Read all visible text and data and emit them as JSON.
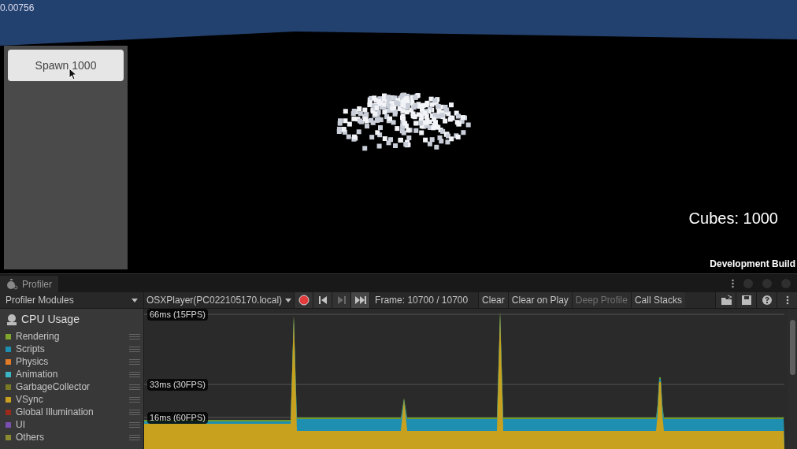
{
  "game_view": {
    "fps_readout": "0.00756",
    "spawn_button": "Spawn 1000",
    "cube_count": "Cubes: 1000",
    "build_label": "Development Build"
  },
  "profiler": {
    "tab": "Profiler",
    "modules_dropdown": "Profiler Modules",
    "target_dropdown": "OSXPlayer(PC022105170.local)",
    "transport": [
      {
        "kind": "record",
        "disabled": false,
        "selected": false
      },
      {
        "kind": "prev",
        "disabled": false,
        "selected": false
      },
      {
        "kind": "next",
        "disabled": true,
        "selected": false
      },
      {
        "kind": "last",
        "disabled": false,
        "selected": true
      }
    ],
    "frame": "Frame: 10700 / 10700",
    "buttons": [
      {
        "label": "Clear",
        "disabled": false
      },
      {
        "label": "Clear on Play",
        "disabled": false
      },
      {
        "label": "Deep Profile",
        "disabled": true
      },
      {
        "label": "Call Stacks",
        "disabled": false
      }
    ],
    "icon_buttons": [
      {
        "kind": "load"
      },
      {
        "kind": "save"
      },
      {
        "kind": "help"
      },
      {
        "kind": "more"
      }
    ],
    "module": {
      "title": "CPU Usage",
      "legend": [
        {
          "label": "Rendering",
          "color": "#7fa52c"
        },
        {
          "label": "Scripts",
          "color": "#1e8fb0"
        },
        {
          "label": "Physics",
          "color": "#e07b27"
        },
        {
          "label": "Animation",
          "color": "#3bb5c4"
        },
        {
          "label": "GarbageCollector",
          "color": "#7a7a26"
        },
        {
          "label": "VSync",
          "color": "#c8a21e"
        },
        {
          "label": "Global Illumination",
          "color": "#9a2a1a"
        },
        {
          "label": "UI",
          "color": "#7a4fb0"
        },
        {
          "label": "Others",
          "color": "#8a8a30"
        }
      ]
    },
    "thresholds": [
      "66ms (15FPS)",
      "33ms (30FPS)",
      "16ms (60FPS)"
    ]
  }
}
